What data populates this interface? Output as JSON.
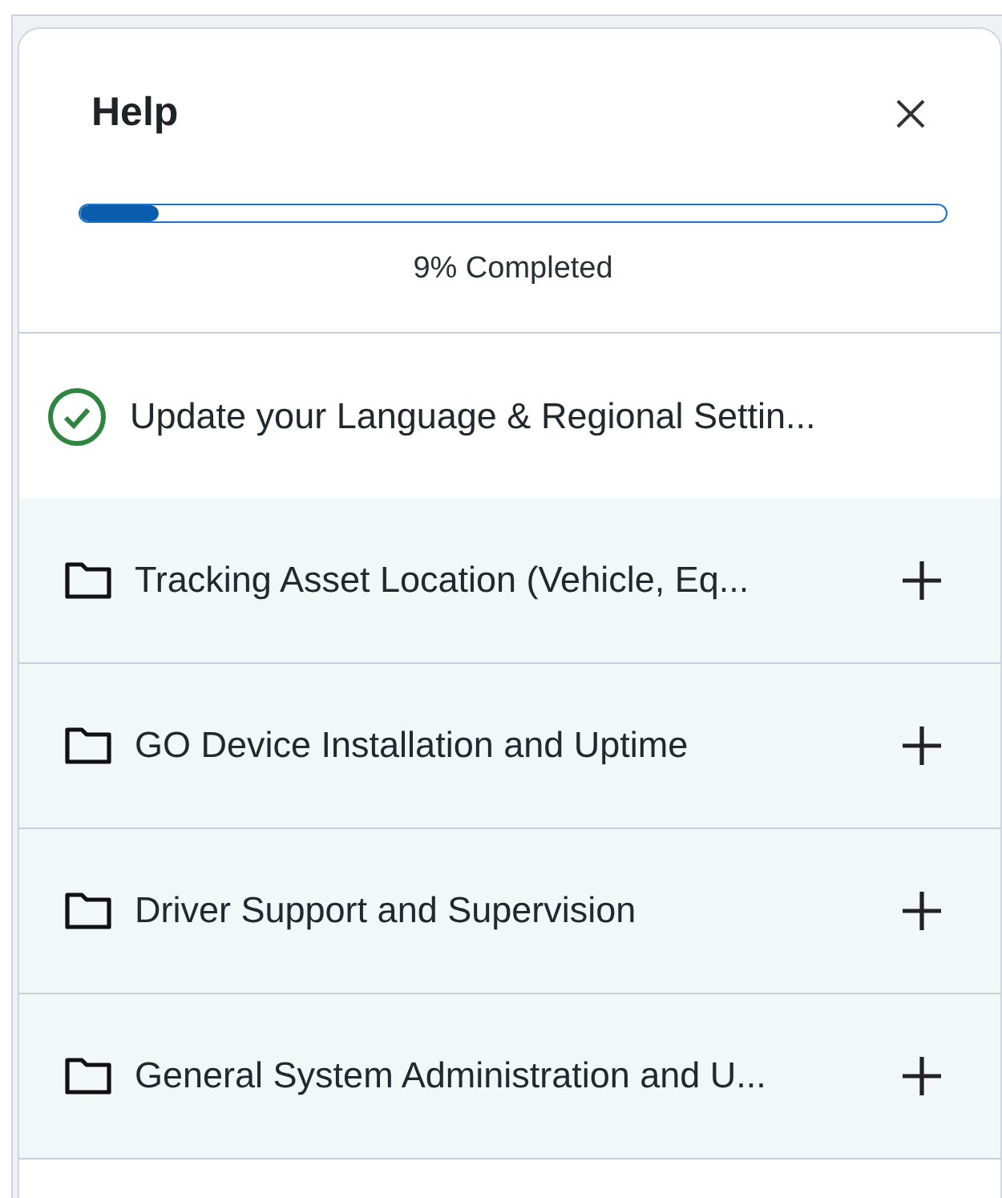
{
  "panel": {
    "title": "Help",
    "progress": {
      "level": 0.09,
      "reading": "9% Completed"
    }
  },
  "items": [
    {
      "kind": "done",
      "label": "Update your Language & Regional Settin..."
    },
    {
      "kind": "folder",
      "label": "Tracking Asset Location (Vehicle, Eq..."
    },
    {
      "kind": "folder",
      "label": "GO Device Installation and Uptime"
    },
    {
      "kind": "folder",
      "label": "Driver Support and Supervision"
    },
    {
      "kind": "folder",
      "label": "General System Administration and U..."
    }
  ]
}
